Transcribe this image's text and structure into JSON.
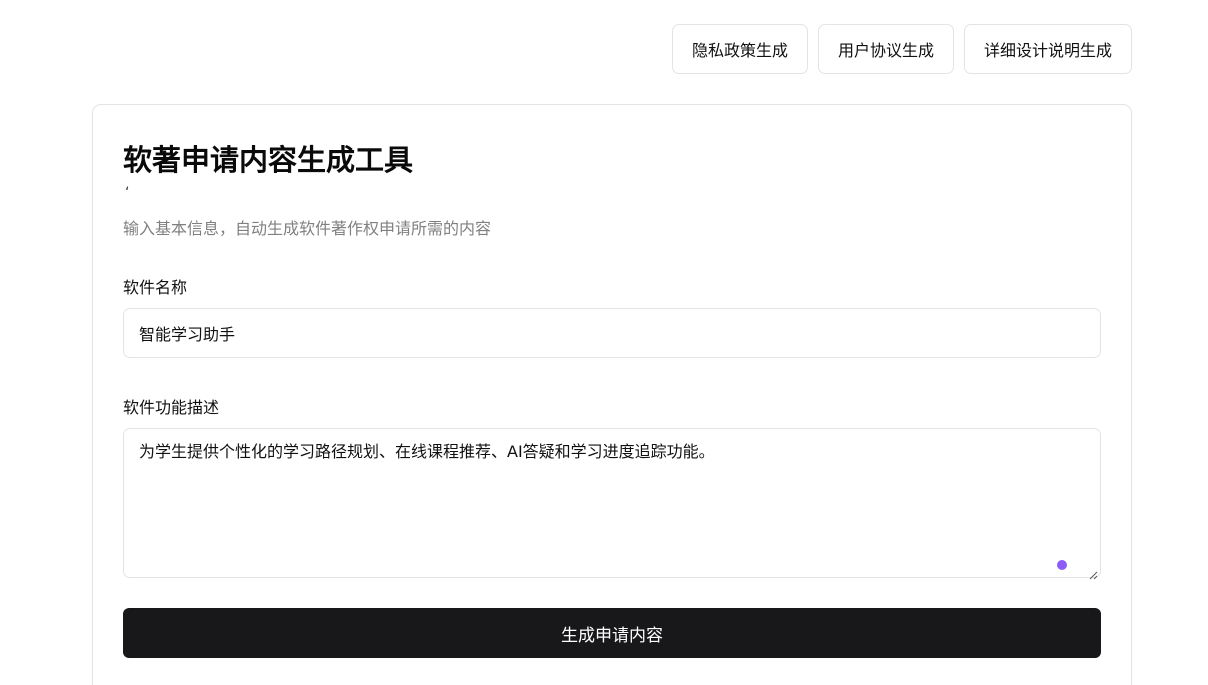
{
  "top_nav": {
    "items": [
      {
        "label": "隐私政策生成"
      },
      {
        "label": "用户协议生成"
      },
      {
        "label": "详细设计说明生成"
      }
    ]
  },
  "form_card": {
    "title": "软著申请内容生成工具",
    "stray_mark": "‘",
    "subtitle": "输入基本信息，自动生成软件著作权申请所需的内容",
    "software_name": {
      "label": "软件名称",
      "value": "智能学习助手"
    },
    "software_description": {
      "label": "软件功能描述",
      "value": "为学生提供个性化的学习路径规划、在线课程推荐、AI答疑和学习进度追踪功能。"
    },
    "submit_label": "生成申请内容"
  },
  "colors": {
    "primary_button": "#18181b",
    "border": "#e4e4e7",
    "muted_text": "#808080",
    "assist_dot": "#8b5cf6"
  },
  "icons": {
    "assist_indicator": "assist-dot-icon",
    "resize": "resize-grip-icon"
  }
}
